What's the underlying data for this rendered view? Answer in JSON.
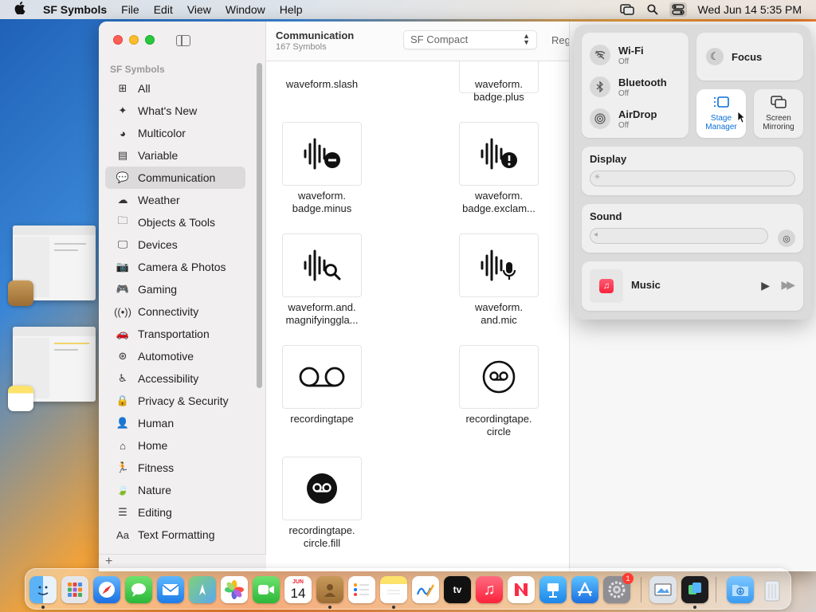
{
  "menubar": {
    "app_name": "SF Symbols",
    "menus": [
      "File",
      "Edit",
      "View",
      "Window",
      "Help"
    ],
    "clock": "Wed Jun 14  5:35 PM"
  },
  "sidebar": {
    "heading": "SF Symbols",
    "items": [
      {
        "label": "All",
        "icon": "grid-icon",
        "glyph": "⊞"
      },
      {
        "label": "What's New",
        "icon": "sparkle-icon",
        "glyph": "✦"
      },
      {
        "label": "Multicolor",
        "icon": "palette-icon",
        "glyph": "◕"
      },
      {
        "label": "Variable",
        "icon": "variable-icon",
        "glyph": "▤"
      },
      {
        "label": "Communication",
        "icon": "speech-bubble-icon",
        "glyph": "💬",
        "selected": true
      },
      {
        "label": "Weather",
        "icon": "cloud-sun-icon",
        "glyph": "☁"
      },
      {
        "label": "Objects & Tools",
        "icon": "folder-icon",
        "glyph": "🗀"
      },
      {
        "label": "Devices",
        "icon": "display-icon",
        "glyph": "🖵"
      },
      {
        "label": "Camera & Photos",
        "icon": "camera-icon",
        "glyph": "📷"
      },
      {
        "label": "Gaming",
        "icon": "gamecontroller-icon",
        "glyph": "🎮"
      },
      {
        "label": "Connectivity",
        "icon": "antenna-icon",
        "glyph": "((•))"
      },
      {
        "label": "Transportation",
        "icon": "car-icon",
        "glyph": "🚗"
      },
      {
        "label": "Automotive",
        "icon": "steering-wheel-icon",
        "glyph": "⊛"
      },
      {
        "label": "Accessibility",
        "icon": "accessibility-icon",
        "glyph": "♿"
      },
      {
        "label": "Privacy & Security",
        "icon": "lock-icon",
        "glyph": "🔒"
      },
      {
        "label": "Human",
        "icon": "person-icon",
        "glyph": "👤"
      },
      {
        "label": "Home",
        "icon": "house-icon",
        "glyph": "⌂"
      },
      {
        "label": "Fitness",
        "icon": "figure-run-icon",
        "glyph": "🏃"
      },
      {
        "label": "Nature",
        "icon": "leaf-icon",
        "glyph": "🍃"
      },
      {
        "label": "Editing",
        "icon": "slider-icon",
        "glyph": "☰"
      },
      {
        "label": "Text Formatting",
        "icon": "textformat-icon",
        "glyph": "Aa"
      }
    ],
    "add_label": "+"
  },
  "toolbar": {
    "title": "Communication",
    "subtitle": "167 Symbols",
    "font_select": "SF Compact",
    "weight": "Regu"
  },
  "symbols": [
    {
      "label_1": "waveform.slash",
      "label_2": ""
    },
    {
      "label_1": "waveform.",
      "label_2": "badge.plus"
    },
    {
      "label_1": "waveform.",
      "label_2": "badge.minus"
    },
    {
      "label_1": "waveform.",
      "label_2": "badge.exclam..."
    },
    {
      "label_1": "waveform.and.",
      "label_2": "magnifyinggla..."
    },
    {
      "label_1": "waveform.",
      "label_2": "and.mic"
    },
    {
      "label_1": "recordingtape",
      "label_2": ""
    },
    {
      "label_1": "recordingtape.",
      "label_2": "circle"
    },
    {
      "label_1": "recordingtape.",
      "label_2": "circle.fill"
    }
  ],
  "control_center": {
    "wifi": {
      "label": "Wi-Fi",
      "status": "Off"
    },
    "bluetooth": {
      "label": "Bluetooth",
      "status": "Off"
    },
    "airdrop": {
      "label": "AirDrop",
      "status": "Off"
    },
    "focus": "Focus",
    "stage_manager": {
      "line1": "Stage",
      "line2": "Manager"
    },
    "screen_mirroring": {
      "line1": "Screen",
      "line2": "Mirroring"
    },
    "display": "Display",
    "sound": "Sound",
    "music": "Music"
  },
  "dock": {
    "calendar_month": "JUN",
    "calendar_day": "14",
    "settings_badge": "1"
  },
  "colors": {
    "accent": "#0a6fd8",
    "selection": "#dcdadb"
  }
}
